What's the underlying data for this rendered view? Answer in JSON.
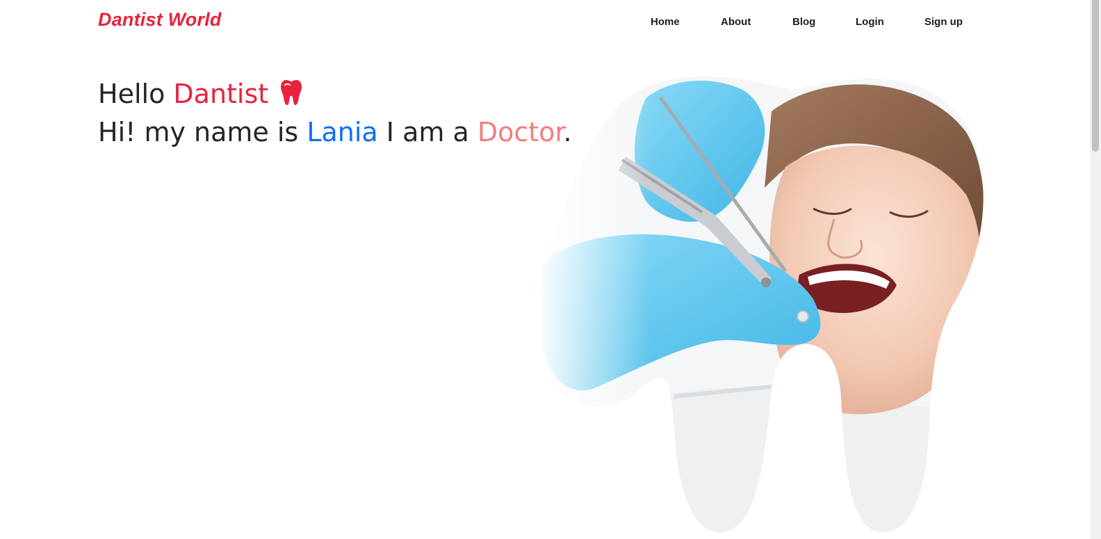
{
  "brand": {
    "name": "Dantist World"
  },
  "nav": {
    "items": [
      {
        "label": "Home"
      },
      {
        "label": "About"
      },
      {
        "label": "Blog"
      },
      {
        "label": "Login"
      },
      {
        "label": "Sign up"
      }
    ]
  },
  "hero": {
    "line1": {
      "prefix": "Hello ",
      "highlight": "Dantist",
      "icon": "tooth-icon"
    },
    "line2": {
      "prefix": "Hi! my name is ",
      "name": "Lania",
      "middle": " I am a ",
      "role": "Doctor",
      "suffix": "."
    },
    "image": {
      "subject": "dentist-patient-photo"
    }
  },
  "colors": {
    "brand_red": "#e8223c",
    "name_blue": "#0d6efd",
    "role_pink": "#f47c7c",
    "text_dark": "#212529",
    "glove_blue": "#5cc8f0"
  }
}
